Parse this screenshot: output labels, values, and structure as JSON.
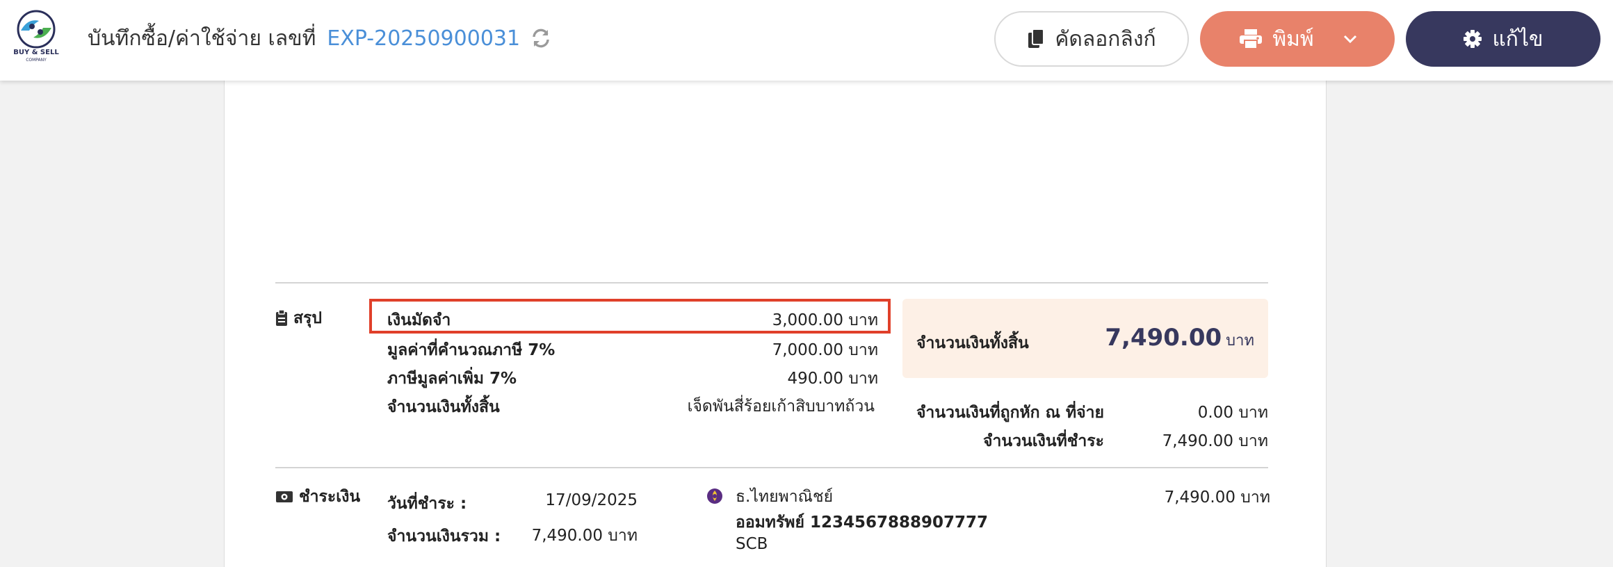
{
  "header": {
    "logo_name": "BUY & SELL",
    "logo_sub": "COMPANY",
    "title": "บันทึกซื้อ/ค่าใช้จ่าย เลขที่",
    "doc_number": "EXP-20250900031",
    "copy_link_label": "คัดลอกลิงก์",
    "print_label": "พิมพ์",
    "edit_label": "แก้ไข"
  },
  "summary": {
    "section_label": "สรุป",
    "deposit_label": "เงินมัดจำ",
    "deposit_value": "3,000.00 บาท",
    "taxable_label": "มูลค่าที่คำนวณภาษี 7%",
    "taxable_value": "7,000.00 บาท",
    "vat_label": "ภาษีมูลค่าเพิ่ม 7%",
    "vat_value": "490.00 บาท",
    "total_text_label": "จำนวนเงินทั้งสิ้น",
    "total_text_value": "เจ็ดพันสี่ร้อยเก้าสิบบาทถ้วน",
    "grand_total_label": "จำนวนเงินทั้งสิ้น",
    "grand_total_value": "7,490.00",
    "grand_total_unit": "บาท",
    "withheld_label": "จำนวนเงินที่ถูกหัก ณ ที่จ่าย",
    "withheld_value": "0.00 บาท",
    "paid_label": "จำนวนเงินที่ชำระ",
    "paid_value": "7,490.00 บาท"
  },
  "payment": {
    "section_label": "ชำระเงิน",
    "date_label": "วันที่ชำระ :",
    "date_value": "17/09/2025",
    "sum_label": "จำนวนเงินรวม :",
    "sum_value": "7,490.00 บาท",
    "bank_name": "ธ.ไทยพาณิชย์",
    "account": "ออมทรัพย์ 1234567888907777",
    "bank_code": "SCB",
    "amount": "7,490.00 บาท"
  },
  "colors": {
    "accent_blue": "#4a8fd8",
    "print_button": "#e8826a",
    "edit_button": "#37385e",
    "highlight_border": "#e0402a",
    "total_box_bg": "#fdf0e6"
  },
  "icons": [
    "refresh-icon",
    "copy-icon",
    "printer-icon",
    "chevron-down-icon",
    "gear-icon",
    "clipboard-icon",
    "money-icon",
    "bank-icon"
  ]
}
